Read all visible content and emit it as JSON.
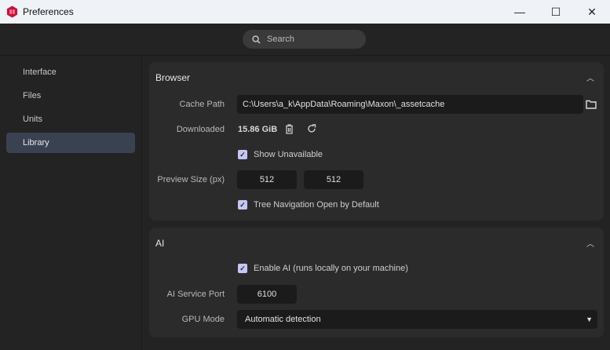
{
  "window": {
    "title": "Preferences",
    "minimize": "—",
    "maximize": "☐",
    "close": "✕"
  },
  "search": {
    "placeholder": "Search"
  },
  "sidebar": {
    "items": [
      {
        "label": "Interface"
      },
      {
        "label": "Files"
      },
      {
        "label": "Units"
      },
      {
        "label": "Library"
      }
    ]
  },
  "browser": {
    "title": "Browser",
    "cache_path_label": "Cache Path",
    "cache_path": "C:\\Users\\a_k\\AppData\\Roaming\\Maxon\\_assetcache",
    "downloaded_label": "Downloaded",
    "downloaded": "15.86 GiB",
    "show_unavailable": "Show Unavailable",
    "preview_size_label": "Preview Size (px)",
    "preview_w": "512",
    "preview_h": "512",
    "tree_nav": "Tree Navigation Open by Default"
  },
  "ai": {
    "title": "AI",
    "enable_ai": "Enable AI (runs locally on your machine)",
    "port_label": "AI Service Port",
    "port": "6100",
    "gpu_label": "GPU Mode",
    "gpu_value": "Automatic detection"
  }
}
